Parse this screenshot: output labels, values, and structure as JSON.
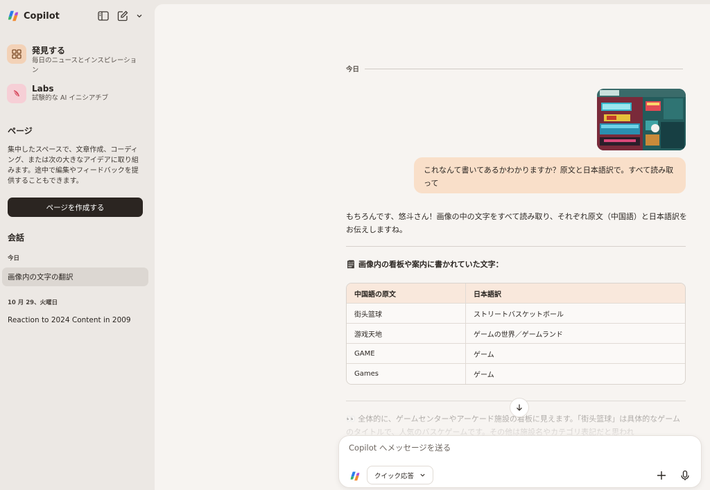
{
  "app": {
    "name": "Copilot"
  },
  "nav": [
    {
      "title": "発見する",
      "subtitle": "毎日のニュースとインスピレーション",
      "icon": "grid-icon",
      "color": "#f3d2b7"
    },
    {
      "title": "Labs",
      "subtitle": "試験的な AI イニシアチブ",
      "icon": "labs-icon",
      "color": "#f6cfd6"
    }
  ],
  "pages": {
    "heading": "ページ",
    "description": "集中したスペースで、文章作成、コーディング、または次の大きなアイデアに取り組みます。途中で編集やフィードバックを提供することもできます。",
    "create_label": "ページを作成する"
  },
  "conversations": {
    "heading": "会話",
    "groups": [
      {
        "date": "今日",
        "items": [
          "画像内の文字の翻訳"
        ]
      },
      {
        "date": "10 月 29、火曜日",
        "items": [
          "Reaction to 2024 Content in 2009"
        ]
      }
    ]
  },
  "chat": {
    "date_label": "今日",
    "user_message": "これなんて書いてあるかわかりますか？原文と日本語訳で。すべて読み取って",
    "ai_intro": "もちろんです、悠斗さん！画像の中の文字をすべて読み取り、それぞれ原文（中国語）と日本語訳をお伝えしますね。",
    "ai_heading_icon": "🗒",
    "ai_heading": "画像内の看板や案内に書かれていた文字：",
    "table": {
      "headers": [
        "中国語の原文",
        "日本語訳"
      ],
      "rows": [
        [
          "街头篮球",
          "ストリートバスケットボール"
        ],
        [
          "游戏天地",
          "ゲームの世界／ゲームランド"
        ],
        [
          "GAME",
          "ゲーム"
        ],
        [
          "Games",
          "ゲーム"
        ]
      ]
    },
    "ai_followup": "👀 全体的に、ゲームセンターやアーケード施設の看板に見えます。「街头篮球」は具体的なゲームのタイトルで、人気のバスケゲームです。その他は施設名やカテゴリ表記だと思われ"
  },
  "composer": {
    "placeholder": "Copilot へメッセージを送る",
    "quick_label": "クイック応答"
  }
}
